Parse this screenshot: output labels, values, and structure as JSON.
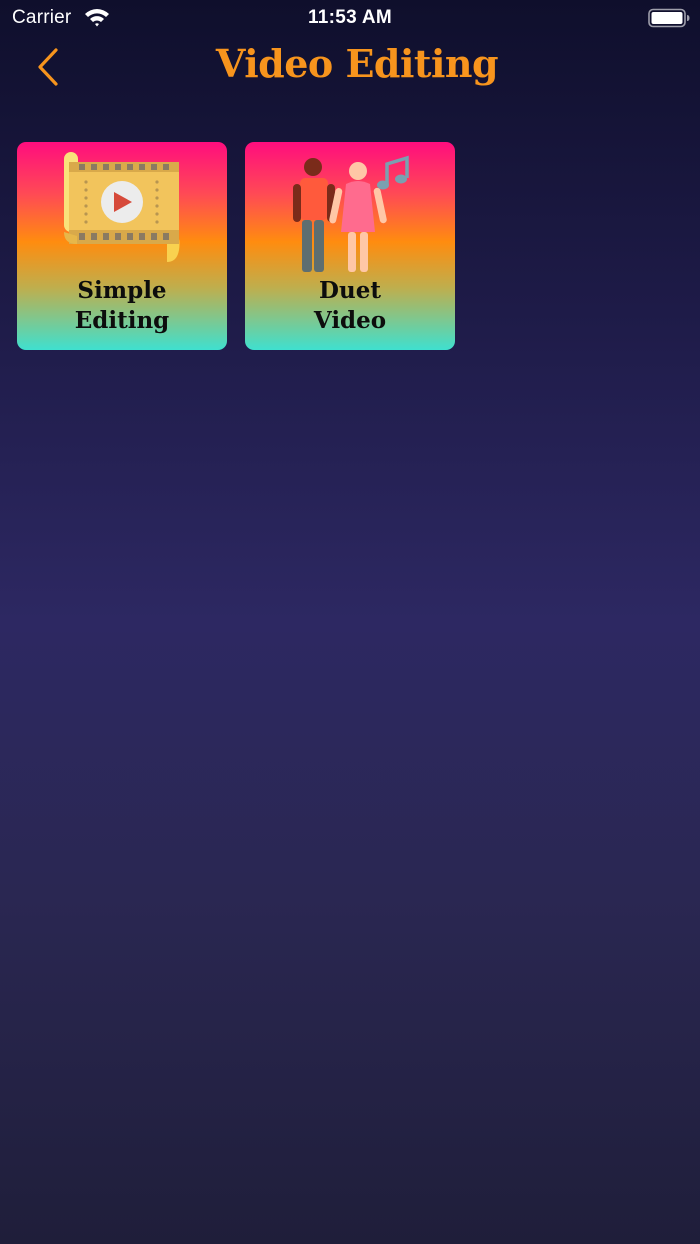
{
  "status_bar": {
    "carrier": "Carrier",
    "time": "11:53 AM",
    "icons": [
      "wifi-icon",
      "battery-icon"
    ]
  },
  "header": {
    "back_icon": "chevron-left-icon",
    "title": "Video Editing",
    "accent_color": "#f7941d"
  },
  "tiles": [
    {
      "label": "Simple\nEditing",
      "icon": "film-scroll-play-icon"
    },
    {
      "label": "Duet\nVideo",
      "icon": "couple-music-icon"
    }
  ],
  "colors": {
    "tile_gradient": [
      "#ff0d7e",
      "#ff8c0f",
      "#3fe0cf"
    ],
    "background": [
      "#0f0f2c",
      "#2d2862",
      "#1f1e3a"
    ]
  }
}
